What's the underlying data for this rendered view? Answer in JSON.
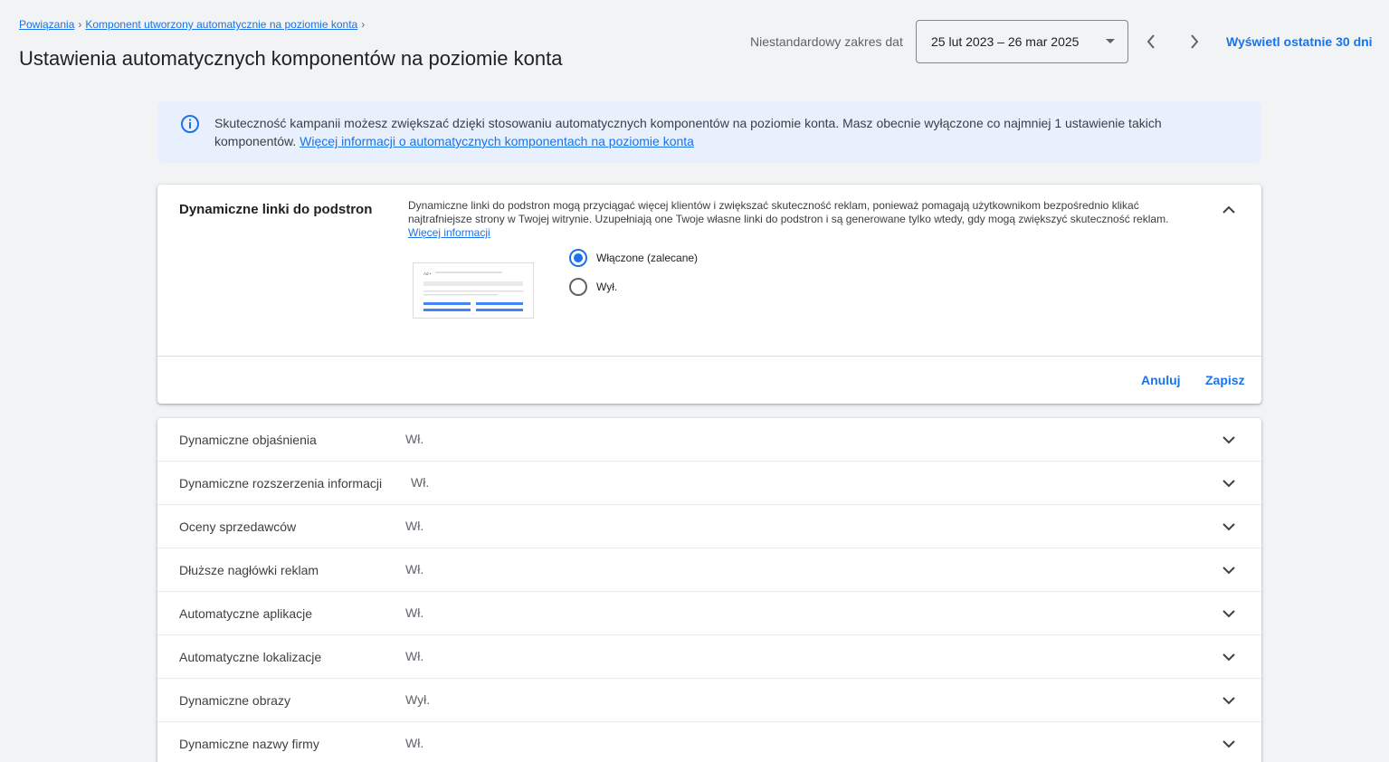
{
  "breadcrumb": {
    "items": [
      "Powiązania",
      "Komponent utworzony automatycznie na poziomie konta"
    ]
  },
  "page_title": "Ustawienia automatycznych komponentów na poziomie konta",
  "date_range": {
    "label": "Niestandardowy zakres dat",
    "value": "25 lut 2023 – 26 mar 2025",
    "show_last_30": "Wyświetl ostatnie 30 dni"
  },
  "banner": {
    "text": "Skuteczność kampanii możesz zwiększać dzięki stosowaniu automatycznych komponentów na poziomie konta. Masz obecnie wyłączone co najmniej 1 ustawienie takich komponentów. ",
    "link": "Więcej informacji o automatycznych komponentach na poziomie konta",
    "icon": "info-icon",
    "accent": "#1a73e8"
  },
  "expanded_card": {
    "title": "Dynamiczne linki do podstron",
    "description": "Dynamiczne linki do podstron mogą przyciągać więcej klientów i zwiększać skuteczność reklam, ponieważ pomagają użytkownikom bezpośrednio klikać najtrafniejsze strony w Twojej witrynie. Uzupełniają one Twoje własne linki do podstron i są generowane tylko wtedy, gdy mogą zwiększyć skuteczność reklam. ",
    "link": "Więcej informacji",
    "preview_ad_label": "Ad •",
    "options": [
      {
        "label": "Włączone (zalecane)",
        "checked": true
      },
      {
        "label": "Wył.",
        "checked": false
      }
    ],
    "cancel": "Anuluj",
    "save": "Zapisz"
  },
  "settings": [
    {
      "label": "Dynamiczne objaśnienia",
      "status": "Wł."
    },
    {
      "label": "Dynamiczne rozszerzenia informacji",
      "status": "Wł."
    },
    {
      "label": "Oceny sprzedawców",
      "status": "Wł."
    },
    {
      "label": "Dłuższe nagłówki reklam",
      "status": "Wł."
    },
    {
      "label": "Automatyczne aplikacje",
      "status": "Wł."
    },
    {
      "label": "Automatyczne lokalizacje",
      "status": "Wł."
    },
    {
      "label": "Dynamiczne obrazy",
      "status": "Wył."
    },
    {
      "label": "Dynamiczne nazwy firmy",
      "status": "Wł."
    }
  ]
}
